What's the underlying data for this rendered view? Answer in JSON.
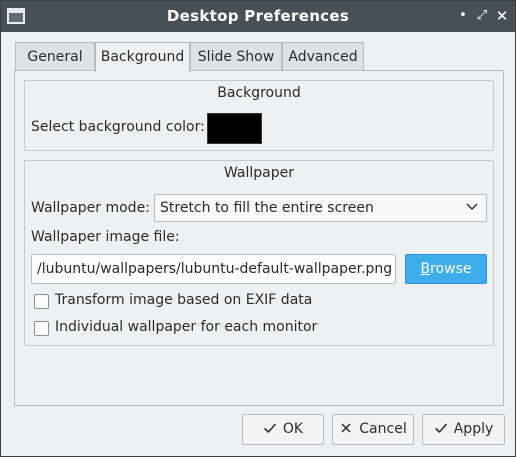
{
  "window": {
    "title": "Desktop Preferences",
    "controls": {
      "minimize": "•",
      "maximize": "⤢",
      "close": "✕"
    }
  },
  "tabs": [
    {
      "label": "General",
      "active": false
    },
    {
      "label": "Background",
      "active": true
    },
    {
      "label": "Slide Show",
      "active": false
    },
    {
      "label": "Advanced",
      "active": false
    }
  ],
  "background_group": {
    "title": "Background",
    "color_label": "Select background color:",
    "color_value": "#000000"
  },
  "wallpaper_group": {
    "title": "Wallpaper",
    "mode_label": "Wallpaper mode:",
    "mode_value": "Stretch to fill the entire screen",
    "file_label": "Wallpaper image file:",
    "file_value": "/lubuntu/wallpapers/lubuntu-default-wallpaper.png",
    "browse_mnemonic": "B",
    "browse_rest": "rowse",
    "exif_label": "Transform image based on EXIF data",
    "exif_checked": false,
    "per_monitor_label": "Individual wallpaper for each monitor",
    "per_monitor_checked": false
  },
  "buttons": {
    "ok": "OK",
    "cancel": "Cancel",
    "apply": "Apply"
  },
  "colors": {
    "titlebar": "#475057",
    "accent": "#3daee9",
    "window_bg": "#eff0f1"
  },
  "icons": {
    "ok": "check-icon",
    "cancel": "x-icon",
    "apply": "check-icon",
    "combo": "chevron-down-icon"
  }
}
